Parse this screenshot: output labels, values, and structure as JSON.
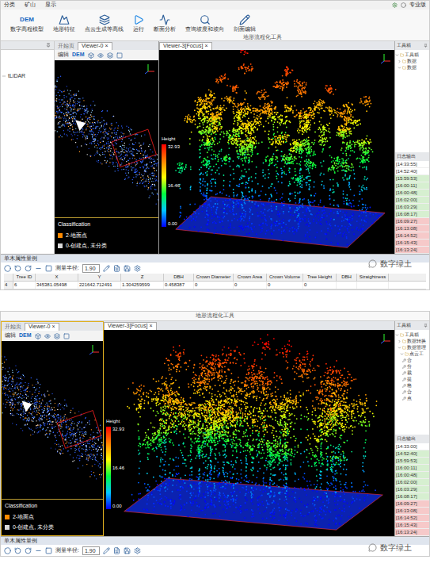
{
  "watermark": "数字绿土",
  "screens": [
    {
      "menu": [
        "分类",
        "矿山",
        "显示"
      ],
      "edition": "专业版",
      "ribbon": {
        "group": "地形流程化工具",
        "tools": [
          {
            "label": "数字高程模型",
            "kind": "dem",
            "icon_text": "DEM"
          },
          {
            "label": "地形特征",
            "kind": "terrain"
          },
          {
            "label": "点云生成等高线",
            "kind": "contour"
          },
          {
            "label": "运行",
            "kind": "run"
          },
          {
            "label": "断面分析",
            "kind": "section"
          },
          {
            "label": "查询坡度和坡向",
            "kind": "slope"
          },
          {
            "label": "剖面编辑",
            "kind": "profile"
          }
        ]
      },
      "left_strip": {
        "item": "tLiDAR"
      },
      "viewer_left": {
        "tabs": [
          {
            "label": "开始页",
            "selected": false
          },
          {
            "label": "Viewer-0",
            "selected": true
          }
        ],
        "close": "×",
        "edit": "编辑",
        "dem": "DEM",
        "highlighted": false,
        "legend": {
          "title": "Classification",
          "items": [
            {
              "label": "2-地面点",
              "color": "#ff8a00"
            },
            {
              "label": "0-创建点, 未分类",
              "color": "#d9d9d9"
            }
          ]
        }
      },
      "viewer_main": {
        "tab": "Viewer-3[Focus]",
        "close": "×",
        "colorbar": {
          "title": "Height",
          "ticks": [
            "32.93",
            "16.46",
            "0.00"
          ]
        }
      },
      "toolbox": {
        "title": "工具箱",
        "items": [
          {
            "label": "工具箱",
            "expanded": true,
            "depth": 0
          },
          {
            "label": "数据",
            "expanded": false,
            "depth": 1
          },
          {
            "label": "数据",
            "expanded": true,
            "depth": 1
          }
        ]
      },
      "log": {
        "title": "日志输出",
        "entries": [
          {
            "time": "[14:33:55]",
            "color": "#ffffff"
          },
          {
            "time": "[14:52:40]",
            "color": "#ffffff"
          },
          {
            "time": "[15:59:53]",
            "color": "#d6efd0"
          },
          {
            "time": "[16:00:11]",
            "color": "#d6efd0"
          },
          {
            "time": "[16:00:48]",
            "color": "#d6efd0"
          },
          {
            "time": "[16:02:00]",
            "color": "#d6efd0"
          },
          {
            "time": "[16:03:29]",
            "color": "#d6efd0"
          },
          {
            "time": "[16:08:17]",
            "color": "#d6efd0"
          },
          {
            "time": "[16:09:27]",
            "color": "#f6c9c9"
          },
          {
            "time": "[16:13:08]",
            "color": "#f6c9c9"
          },
          {
            "time": "[16:14:52]",
            "color": "#f6c9c9"
          },
          {
            "time": "[16:15:43]",
            "color": "#f6c9c9"
          },
          {
            "time": "[16:13:24]",
            "color": "#f6c9c9"
          }
        ]
      },
      "table": {
        "title": "单木属性量例",
        "radius_label": "测量半径:",
        "radius": "1.90",
        "columns": [
          "Tree ID",
          "X",
          "Y",
          "Z",
          "DBH",
          "Crown Diameter",
          "Crown Area",
          "Crown Volume",
          "Tree Height",
          "DBH",
          "Straightness"
        ],
        "rows": [
          {
            "index": "4",
            "cells": [
              "6",
              "345381.05498",
              "221642.712491",
              "1.304259599",
              "0.458387",
              "0",
              "0",
              "0",
              "0"
            ]
          }
        ]
      }
    },
    {
      "group_label": "地形流程化工具",
      "viewer_left": {
        "tabs": [
          {
            "label": "开始页",
            "selected": false
          },
          {
            "label": "Viewer-0",
            "selected": true
          }
        ],
        "close": "×",
        "edit": "编辑",
        "dem": "DEM",
        "highlighted": true,
        "legend": {
          "title": "Classification",
          "items": [
            {
              "label": "2-地面点",
              "color": "#ff8a00"
            },
            {
              "label": "0-创建点, 未分类",
              "color": "#d9d9d9"
            }
          ]
        }
      },
      "viewer_main": {
        "tab": "Viewer-3[Focus]",
        "close": "×",
        "colorbar": {
          "title": "Height",
          "ticks": [
            "32.93",
            "16.46",
            "0.00"
          ]
        }
      },
      "toolbox": {
        "title": "工具箱",
        "items": [
          {
            "label": "工具箱",
            "expanded": true,
            "depth": 0
          },
          {
            "label": "数据转换",
            "expanded": false,
            "depth": 1
          },
          {
            "label": "数据管理",
            "expanded": true,
            "depth": 1
          },
          {
            "label": "点云工",
            "expanded": true,
            "depth": 2
          },
          {
            "label": "合",
            "depth": 3
          },
          {
            "label": "分",
            "depth": 3
          },
          {
            "label": "裁",
            "depth": 3
          },
          {
            "label": "提",
            "depth": 3
          },
          {
            "label": "格",
            "depth": 3
          },
          {
            "label": "合",
            "depth": 3
          },
          {
            "label": "点",
            "depth": 3
          }
        ]
      },
      "log": {
        "title": "日志输出",
        "entries": [
          {
            "time": "[14:33:00]",
            "color": "#ffffff"
          },
          {
            "time": "[14:52:40]",
            "color": "#d6efd0"
          },
          {
            "time": "[15:59:53]",
            "color": "#d6efd0"
          },
          {
            "time": "[16:00:11]",
            "color": "#d6efd0"
          },
          {
            "time": "[16:00:48]",
            "color": "#d6efd0"
          },
          {
            "time": "[16:02:00]",
            "color": "#d6efd0"
          },
          {
            "time": "[16:03:29]",
            "color": "#d6efd0"
          },
          {
            "time": "[16:08:17]",
            "color": "#d6efd0"
          },
          {
            "time": "[16:09:27]",
            "color": "#f6c9c9"
          },
          {
            "time": "[16:13:08]",
            "color": "#f6c9c9"
          },
          {
            "time": "[16:14:52]",
            "color": "#f6c9c9"
          },
          {
            "time": "[16:15:43]",
            "color": "#f6c9c9"
          },
          {
            "time": "[16:13:24]",
            "color": "#f6c9c9"
          }
        ]
      },
      "table": {
        "title": "单木属性量例",
        "radius_label": "测量半径:",
        "radius": "1.90"
      }
    }
  ]
}
